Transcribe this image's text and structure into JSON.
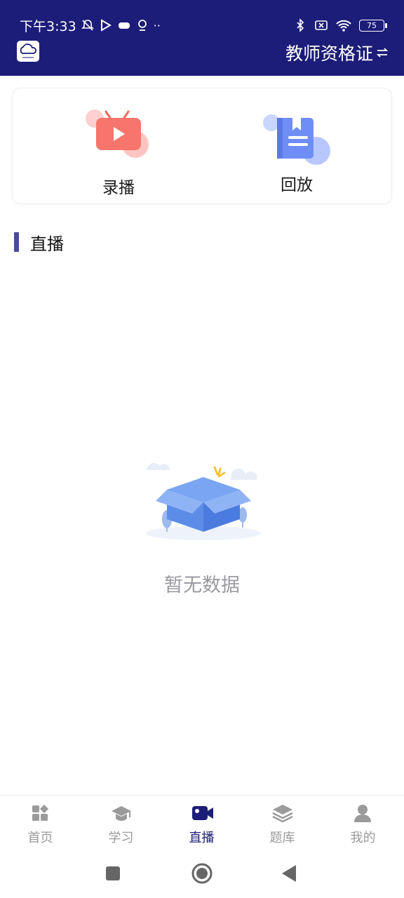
{
  "status_bar": {
    "time": "下午3:33",
    "battery": "75"
  },
  "header": {
    "exam_name": "教师资格证",
    "switch_icon": "swap-arrows-icon"
  },
  "shortcuts": [
    {
      "label": "录播",
      "icon": "tv-play-icon"
    },
    {
      "label": "回放",
      "icon": "notebook-icon"
    }
  ],
  "section": {
    "title": "直播"
  },
  "empty_state": {
    "text": "暂无数据",
    "icon": "empty-box-icon"
  },
  "tabs": [
    {
      "label": "首页",
      "icon": "grid-icon",
      "active": false
    },
    {
      "label": "学习",
      "icon": "graduation-cap-icon",
      "active": false
    },
    {
      "label": "直播",
      "icon": "video-camera-icon",
      "active": true
    },
    {
      "label": "题库",
      "icon": "layers-icon",
      "active": false
    },
    {
      "label": "我的",
      "icon": "person-icon",
      "active": false
    }
  ],
  "colors": {
    "primary": "#1c1d79",
    "accent_bar": "#4b4a9c",
    "tab_inactive": "#9a9a9a",
    "empty_text": "#9a9aa0"
  }
}
